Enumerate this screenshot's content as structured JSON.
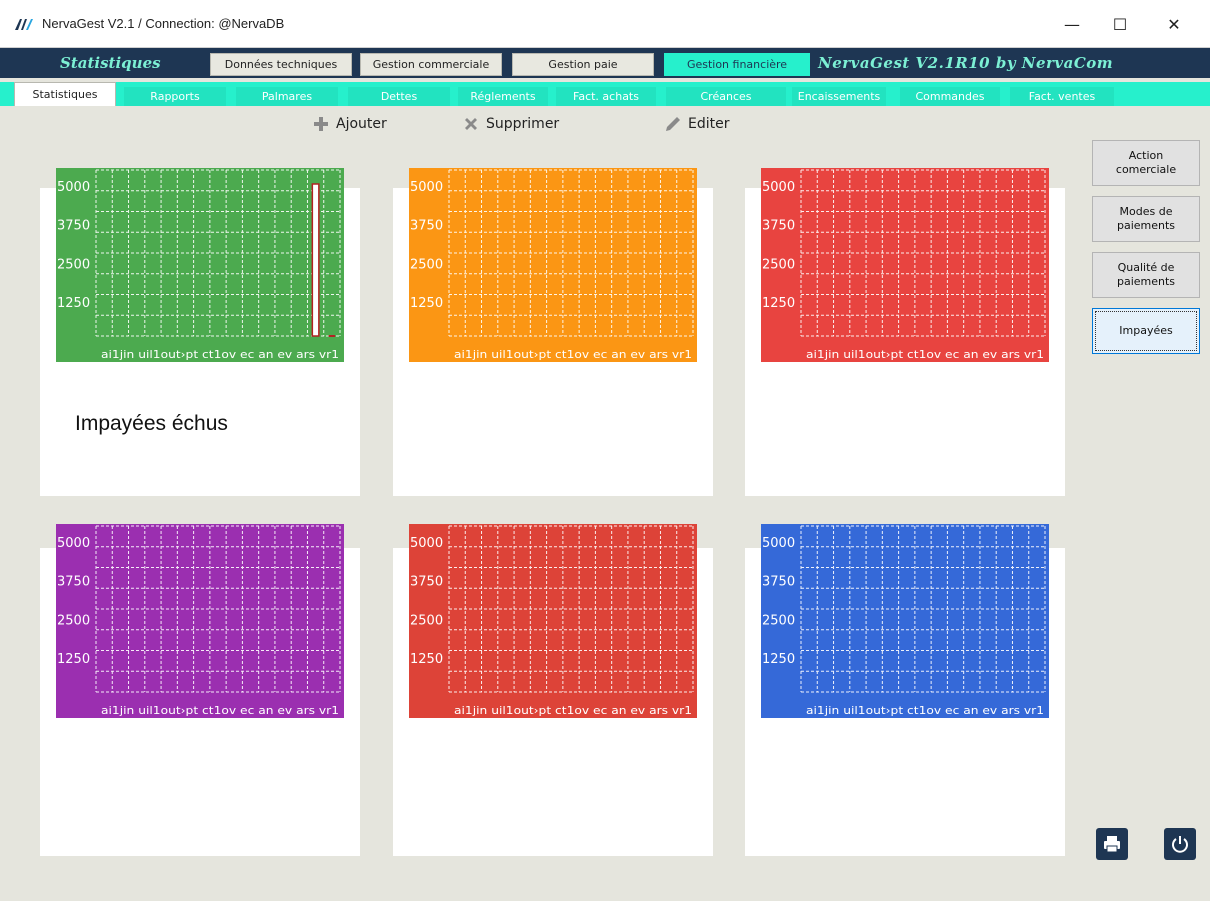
{
  "window": {
    "title": "NervaGest V2.1 / Connection: @NervaDB",
    "minimize": "—",
    "maximize": "☐",
    "close": "✕"
  },
  "header": {
    "brand_left": "Statistiques",
    "brand_right": "NervaGest V2.1R10 by NervaCom",
    "tabs": [
      {
        "label": "Données techniques"
      },
      {
        "label": "Gestion commerciale"
      },
      {
        "label": "Gestion paie"
      },
      {
        "label": "Gestion financière"
      }
    ]
  },
  "subtabs": [
    {
      "label": "Statistiques"
    },
    {
      "label": "Rapports"
    },
    {
      "label": "Palmares"
    },
    {
      "label": "Dettes"
    },
    {
      "label": "Réglements"
    },
    {
      "label": "Fact. achats"
    },
    {
      "label": "Créances"
    },
    {
      "label": "Encaissements"
    },
    {
      "label": "Commandes"
    },
    {
      "label": "Fact. ventes"
    }
  ],
  "toolbar": {
    "add": "Ajouter",
    "delete": "Supprimer",
    "edit": "Editer"
  },
  "cards": [
    {
      "caption": "Impayées échus"
    },
    {
      "caption": ""
    },
    {
      "caption": ""
    },
    {
      "caption": ""
    },
    {
      "caption": ""
    },
    {
      "caption": ""
    }
  ],
  "chart_data": [
    {
      "type": "bar",
      "color": "#4caa4f",
      "y_ticks": [
        "5000",
        "3750",
        "2500",
        "1250"
      ],
      "x_tick_text": "ai1jin uil1out›pt ct1ov ec an ev ars vr1",
      "ylim": [
        0,
        5000
      ],
      "values": [
        0,
        0,
        0,
        0,
        0,
        0,
        0,
        0,
        0,
        0,
        0,
        0,
        0,
        5000,
        0
      ]
    },
    {
      "type": "bar",
      "color": "#fb9614",
      "y_ticks": [
        "5000",
        "3750",
        "2500",
        "1250"
      ],
      "x_tick_text": "ai1jin uil1out›pt ct1ov ec an ev ars vr1",
      "ylim": [
        0,
        5000
      ],
      "values": []
    },
    {
      "type": "bar",
      "color": "#e84440",
      "y_ticks": [
        "5000",
        "3750",
        "2500",
        "1250"
      ],
      "x_tick_text": "ai1jin uil1out›pt ct1ov ec an ev ars vr1",
      "ylim": [
        0,
        5000
      ],
      "values": []
    },
    {
      "type": "bar",
      "color": "#9b2fb0",
      "y_ticks": [
        "5000",
        "3750",
        "2500",
        "1250"
      ],
      "x_tick_text": "ai1jin uil1out›pt ct1ov ec an ev ars vr1",
      "ylim": [
        0,
        5000
      ],
      "values": []
    },
    {
      "type": "bar",
      "color": "#dd4338",
      "y_ticks": [
        "5000",
        "3750",
        "2500",
        "1250"
      ],
      "x_tick_text": "ai1jin uil1out›pt ct1ov ec an ev ars vr1",
      "ylim": [
        0,
        5000
      ],
      "values": []
    },
    {
      "type": "bar",
      "color": "#3569d8",
      "y_ticks": [
        "5000",
        "3750",
        "2500",
        "1250"
      ],
      "x_tick_text": "ai1jin uil1out›pt ct1ov ec an ev ars vr1",
      "ylim": [
        0,
        5000
      ],
      "values": []
    }
  ],
  "side_buttons": [
    {
      "label": "Action comerciale"
    },
    {
      "label": "Modes de paiements"
    },
    {
      "label": "Qualité de paiements"
    },
    {
      "label": "Impayées"
    }
  ],
  "icons": {
    "print": "printer-icon",
    "power": "power-icon"
  }
}
